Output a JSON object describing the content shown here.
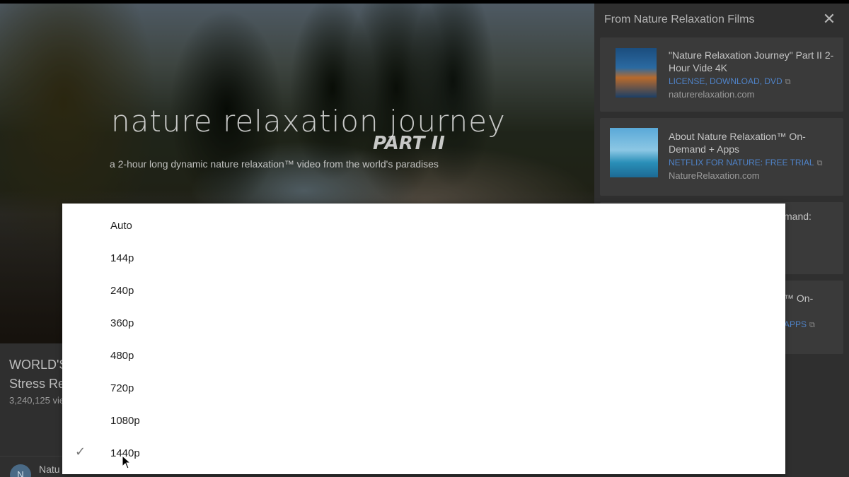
{
  "video": {
    "overlay_title": "nature relaxation journey",
    "overlay_part": "PART II",
    "overlay_subtitle": "a 2-hour long dynamic nature relaxation™ video from the world's paradises"
  },
  "below_video": {
    "title_line1": "WORLD'S",
    "title_line2": "Stress Re",
    "views": "3,240,125 vie",
    "channel_name": "Natu"
  },
  "sidebar": {
    "title": "From Nature Relaxation Films",
    "close_icon": "close-icon",
    "cards": [
      {
        "title": "\"Nature Relaxation Journey\" Part II 2-Hour Vide 4K",
        "link": "LICENSE, DOWNLOAD, DVD",
        "domain": "naturerelaxation.com"
      },
      {
        "title": "About Nature Relaxation™ On-Demand + Apps",
        "link": "NETFLIX FOR NATURE: FREE TRIAL",
        "domain": "NatureRelaxation.com"
      },
      {
        "title_fragment": "mand:"
      },
      {
        "title_fragment": "™ On-",
        "link_fragment": "APPS"
      }
    ]
  },
  "quality_menu": {
    "options": [
      "Auto",
      "144p",
      "240p",
      "360p",
      "480p",
      "720p",
      "1080p",
      "1440p"
    ],
    "selected": "1440p",
    "check_icon": "checkmark-icon"
  }
}
